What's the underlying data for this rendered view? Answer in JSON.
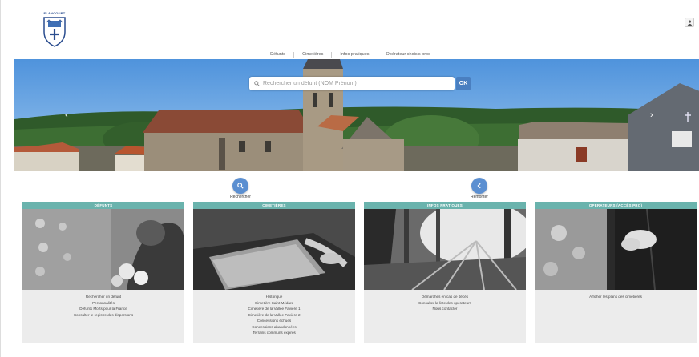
{
  "brand": {
    "town_name": "ELANCOURT"
  },
  "nav": {
    "items": [
      "Défunts",
      "Cimetières",
      "Infos pratiques",
      "Opérateur choisis pros"
    ]
  },
  "search": {
    "placeholder": "Rechercher un défunt (NOM Prénom)",
    "button_label": "OK"
  },
  "actions": {
    "search_label": "Rechercher",
    "back_label": "Remonter"
  },
  "cards": [
    {
      "title": "DÉFUNTS",
      "links": [
        "Rechercher un défunt",
        "Personnalités",
        "Défunts Morts pour la France",
        "Consulter le registre des dispersions"
      ]
    },
    {
      "title": "CIMETIÈRES",
      "links": [
        "Historique",
        "Cimetière Saint Médard",
        "Cimetière de la Vallée Favière 1",
        "Cimetière de la Vallée Favière 2",
        "Concessions échues",
        "Concessions abandonnées",
        "Terrains communs expirés"
      ]
    },
    {
      "title": "INFOS PRATIQUES",
      "links": [
        "Démarches en cas de décès",
        "Consulter la liste des opérateurs",
        "Nous contacter"
      ]
    },
    {
      "title": "OPÉRATEURS (ACCÈS PRO)",
      "links": [
        "Afficher les plans des cimetières"
      ]
    }
  ],
  "colors": {
    "card_header": "#6ab3ad",
    "accent_blue": "#5b8fd1",
    "card_bg": "#ececec"
  }
}
